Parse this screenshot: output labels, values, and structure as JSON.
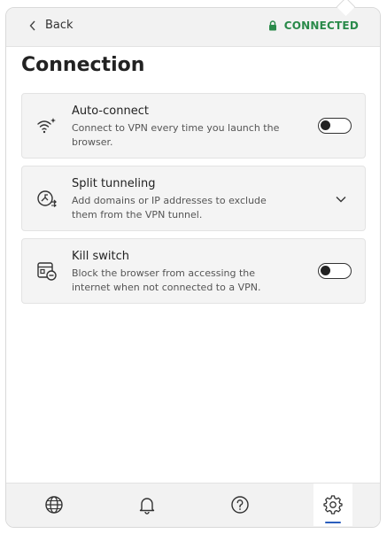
{
  "header": {
    "back_label": "Back",
    "status_label": "CONNECTED",
    "status_color": "#2a8a4a",
    "back_icon": "chevron-left-icon",
    "status_icon": "lock-icon"
  },
  "page": {
    "title": "Connection"
  },
  "settings": [
    {
      "name": "Auto-connect",
      "description": "Connect to VPN every time you launch the browser.",
      "icon": "wifi-sparkle-icon",
      "control": "toggle",
      "enabled": false
    },
    {
      "name": "Split tunneling",
      "description": "Add domains or IP addresses to exclude them from the VPN tunnel.",
      "icon": "split-tunnel-icon",
      "control": "expand",
      "expanded": false
    },
    {
      "name": "Kill switch",
      "description": "Block the browser from accessing the internet when not connected to a VPN.",
      "icon": "browser-block-icon",
      "control": "toggle",
      "enabled": false
    }
  ],
  "bottom_nav": {
    "items": [
      {
        "icon": "globe-icon",
        "active": false
      },
      {
        "icon": "bell-icon",
        "active": false
      },
      {
        "icon": "help-icon",
        "active": false
      },
      {
        "icon": "gear-icon",
        "active": true
      }
    ],
    "active_color": "#2b5ebd"
  }
}
